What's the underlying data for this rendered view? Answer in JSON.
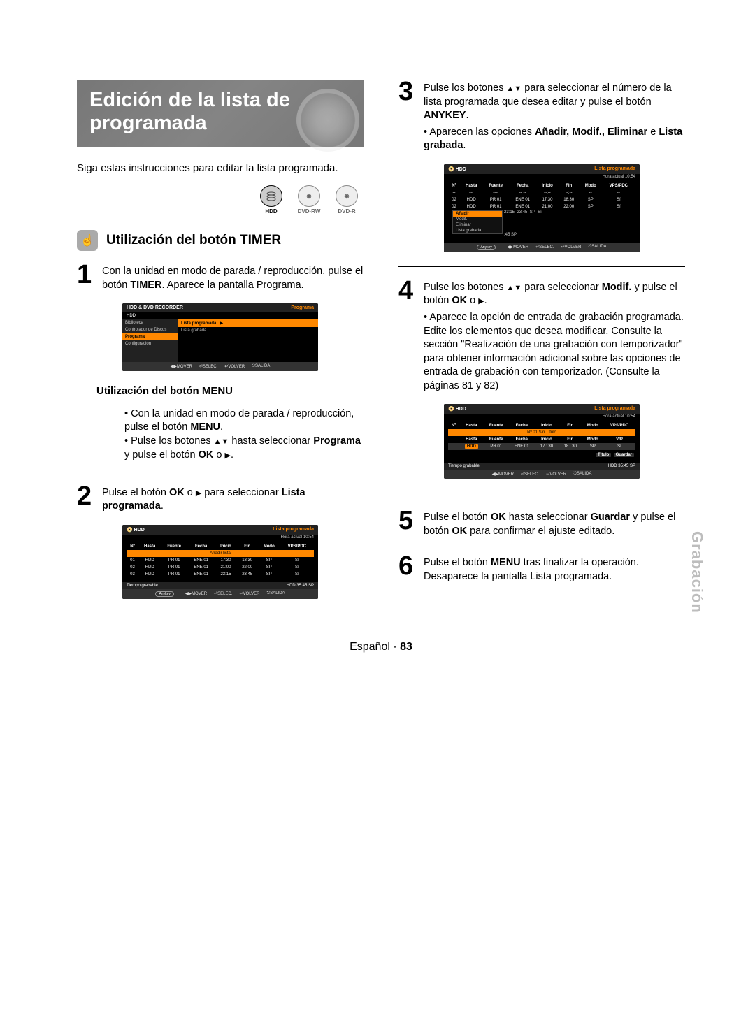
{
  "title": "Edición de la lista de programada",
  "intro": "Siga estas instrucciones para editar la lista programada.",
  "discs": [
    {
      "label": "HDD",
      "active": true
    },
    {
      "label": "DVD-RW",
      "active": false
    },
    {
      "label": "DVD-R",
      "active": false
    }
  ],
  "section_timer": "Utilización del botón TIMER",
  "step1": {
    "text_a": "Con la unidad en modo de parada / reproducción, pulse el botón ",
    "b1": "TIMER",
    "text_b": ". Aparece la pantalla Programa."
  },
  "step2": {
    "text_a": "Pulse el botón ",
    "b1": "OK",
    "text_b": " o ",
    "text_c": " para seleccionar ",
    "b2": "Lista programada",
    "text_d": "."
  },
  "step3": {
    "text_a": "Pulse los botones ",
    "text_b": " para seleccionar el número de la lista programada que desea editar y pulse el botón ",
    "b1": "ANYKEY",
    "text_c": ".",
    "bullet_a": "Aparecen las opciones ",
    "b2": "Añadir, Modif., Eliminar",
    "bullet_b": " e ",
    "b3": "Lista grabada",
    "bullet_c": "."
  },
  "step4": {
    "text_a": "Pulse los botones ",
    "text_b": " para seleccionar ",
    "b1": "Modif.",
    "text_c": " y pulse el botón ",
    "b2": "OK",
    "text_d": " o ",
    "text_e": ".",
    "bullet": "Aparece la opción de entrada de grabación programada. Edite los elementos que desea modificar. Consulte la sección \"Realización de una grabación con temporizador\" para obtener información adicional sobre las opciones de entrada de grabación con temporizador. (Consulte la páginas 81 y 82)"
  },
  "step5": {
    "text_a": "Pulse el botón ",
    "b1": "OK",
    "text_b": " hasta seleccionar ",
    "b2": "Guardar",
    "text_c": " y pulse el botón ",
    "b3": "OK",
    "text_d": " para confirmar el ajuste editado."
  },
  "step6": {
    "text_a": "Pulse el botón ",
    "b1": "MENU",
    "text_b": " tras finalizar la operación. Desaparece la pantalla Lista programada."
  },
  "menu_sub": {
    "title": "Utilización del botón MENU",
    "b1_a": "Con la unidad en modo de parada / reproducción, pulse el botón ",
    "b1_b": "MENU",
    "b1_c": ".",
    "b2_a": "Pulse los botones ",
    "b2_b": " hasta seleccionar ",
    "b2_c": "Programa",
    "b2_d": " y pulse el botón ",
    "b2_e": "OK",
    "b2_f": " o ",
    "b2_g": "."
  },
  "osd1": {
    "title_left": "HDD & DVD RECORDER",
    "title_right": "Programa",
    "hdd": "HDD",
    "left_items": [
      "Biblioteca",
      "Controlador de Discos",
      "Programa",
      "Configuración"
    ],
    "right_items": [
      "Lista programada",
      "Lista grabada"
    ],
    "nav": [
      "MOVER",
      "SELEC.",
      "VOLVER",
      "SALIDA"
    ]
  },
  "osd2": {
    "hdd": "HDD",
    "title_right": "Lista programada",
    "time": "Hora actual 10:54",
    "headers": [
      "Nº",
      "Hasta",
      "Fuente",
      "Fecha",
      "Inicio",
      "Fin",
      "Modo",
      "VPS/PDC"
    ],
    "addrow": "Añadir lista",
    "rows": [
      [
        "01",
        "HDD",
        "PR 01",
        "ENE 01",
        "17:30",
        "18:30",
        "SP",
        "Sí"
      ],
      [
        "02",
        "HDD",
        "PR 01",
        "ENE 01",
        "21:00",
        "22:00",
        "SP",
        "Sí"
      ],
      [
        "03",
        "HDD",
        "PR 01",
        "ENE 01",
        "23:15",
        "23:45",
        "SP",
        "Sí"
      ]
    ],
    "rectime_label": "Tiempo grabable",
    "rectime_val": "HDD  35:45 SP",
    "any": "Anykey",
    "nav": [
      "MOVER",
      "SELEC.",
      "VOLVER",
      "SALIDA"
    ]
  },
  "osd3": {
    "hdd": "HDD",
    "title_right": "Lista programada",
    "time": "Hora actual 10:54",
    "headers": [
      "Nº",
      "Hasta",
      "Fuente",
      "Fecha",
      "Inicio",
      "Fin",
      "Modo",
      "VPS/PDC"
    ],
    "rows_grey": [
      [
        "--",
        "---",
        "----",
        "-- --",
        "--:--",
        "--:--",
        "--",
        "--"
      ]
    ],
    "rows": [
      [
        "02",
        "HDD",
        "PR 01",
        "ENE 01",
        "17:30",
        "18:30",
        "SP",
        "Sí"
      ],
      [
        "02",
        "HDD",
        "PR 01",
        "ENE 01",
        "21:00",
        "22:00",
        "SP",
        "Sí"
      ],
      [
        "",
        "",
        "",
        "",
        "23:15",
        "23:45",
        "SP",
        "Sí"
      ]
    ],
    "ctx": [
      "Añadir",
      "Modif.",
      "Eliminar",
      "Lista grabada"
    ],
    "ctx_tail": ":45 SP",
    "any": "Anykey",
    "nav": [
      "MOVER",
      "SELEC.",
      "VOLVER",
      "SALIDA"
    ]
  },
  "osd4": {
    "hdd": "HDD",
    "title_right": "Lista programada",
    "time": "Hora actual 10:54",
    "headers": [
      "Nº",
      "Hasta",
      "Fuente",
      "Fecha",
      "Inicio",
      "Fin",
      "Modo",
      "VPS/PDC"
    ],
    "banner": "Nº 01 Sin Título",
    "edit_headers": [
      "Hasta",
      "Fuente",
      "Fecha",
      "Inicio",
      "Fin",
      "Modo",
      "V/P"
    ],
    "edit_row": [
      "HDD",
      "PR 01",
      "ENE 01",
      "17 : 30",
      "18 : 30",
      "SP",
      "Sí"
    ],
    "titulo": "Título",
    "guardar": "Guardar",
    "rectime_label": "Tiempo grabable",
    "rectime_val": "HDD  35:45 SP",
    "nav": [
      "MOVER",
      "SELEC.",
      "VOLVER",
      "SALIDA"
    ]
  },
  "side_tab": "Grabación",
  "footer_lang": "Español",
  "footer_page": "83"
}
